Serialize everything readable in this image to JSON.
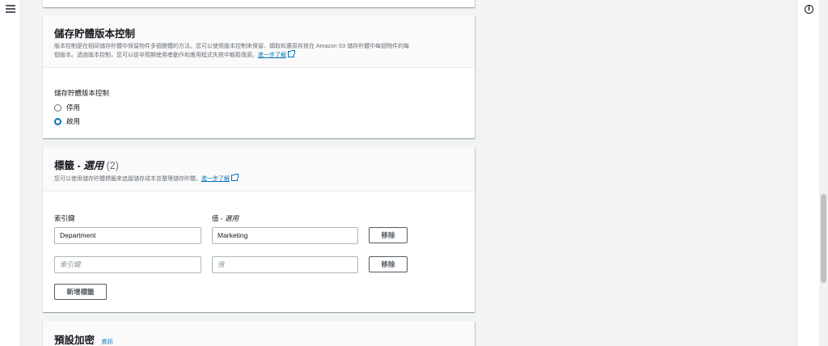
{
  "versioning": {
    "title": "儲存貯體版本控制",
    "description_line1": "版本控制是在相同儲存貯體中保留物件多個變體的方法。您可以使用版本控制來保留、擷取和還原存放在 Amazon S3 儲存貯體中每個物件的每",
    "description_line2": "個版本。透過版本控制，您可以從非預期使用者動作和應用程式失敗中輕鬆復原。",
    "learn_more": "進一步了解",
    "field_label": "儲存貯體版本控制",
    "options": [
      {
        "label": "停用",
        "selected": false
      },
      {
        "label": "啟用",
        "selected": true
      }
    ]
  },
  "tags": {
    "title_main": "標籤 - ",
    "title_optional": "選用",
    "title_count": " (2)",
    "description": "您可以使用儲存貯體標籤來追蹤儲存成本並整理儲存貯體。",
    "learn_more": "進一步了解",
    "key_label": "索引鍵",
    "value_label_main": "值 - ",
    "value_label_optional": "選用",
    "rows": [
      {
        "key": "Department",
        "value": "Marketing",
        "key_placeholder": "",
        "value_placeholder": "",
        "remove": "移除"
      },
      {
        "key": "",
        "value": "",
        "key_placeholder": "索引鍵",
        "value_placeholder": "值",
        "remove": "移除"
      }
    ],
    "add_button": "新增標籤"
  },
  "encryption": {
    "title": "預設加密",
    "info": "資訊"
  },
  "colors": {
    "accent": "#0073bb",
    "background": "#f2f3f3"
  }
}
